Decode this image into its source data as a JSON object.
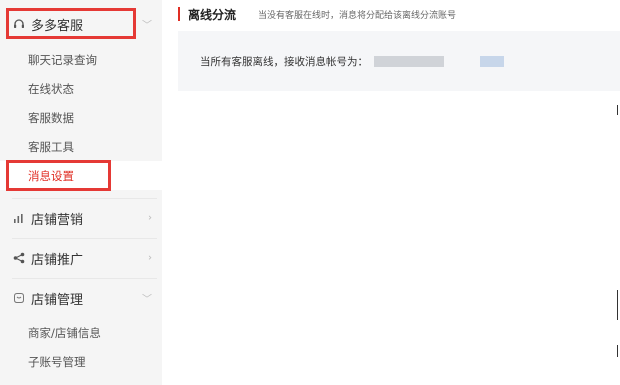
{
  "sidebar": {
    "customer_service": {
      "label": "多多客服",
      "icon": "headset-icon",
      "items": [
        {
          "label": "聊天记录查询"
        },
        {
          "label": "在线状态"
        },
        {
          "label": "客服数据"
        },
        {
          "label": "客服工具"
        },
        {
          "label": "消息设置",
          "active": true
        }
      ]
    },
    "marketing": {
      "label": "店铺营销",
      "icon": "bar-chart-icon"
    },
    "promotion": {
      "label": "店铺推广",
      "icon": "share-icon"
    },
    "management": {
      "label": "店铺管理",
      "icon": "store-icon",
      "items": [
        {
          "label": "商家/店铺信息"
        },
        {
          "label": "子账号管理"
        }
      ]
    }
  },
  "main": {
    "title": "离线分流",
    "description": "当没有客服在线时，消息将分配给该离线分流账号",
    "panel_text": "当所有客服离线，接收消息帐号为："
  },
  "colors": {
    "accent": "#e02e24",
    "highlight": "#e53935",
    "sidebar_bg": "#f5f5f5",
    "panel_bg": "#f5f6f8"
  }
}
